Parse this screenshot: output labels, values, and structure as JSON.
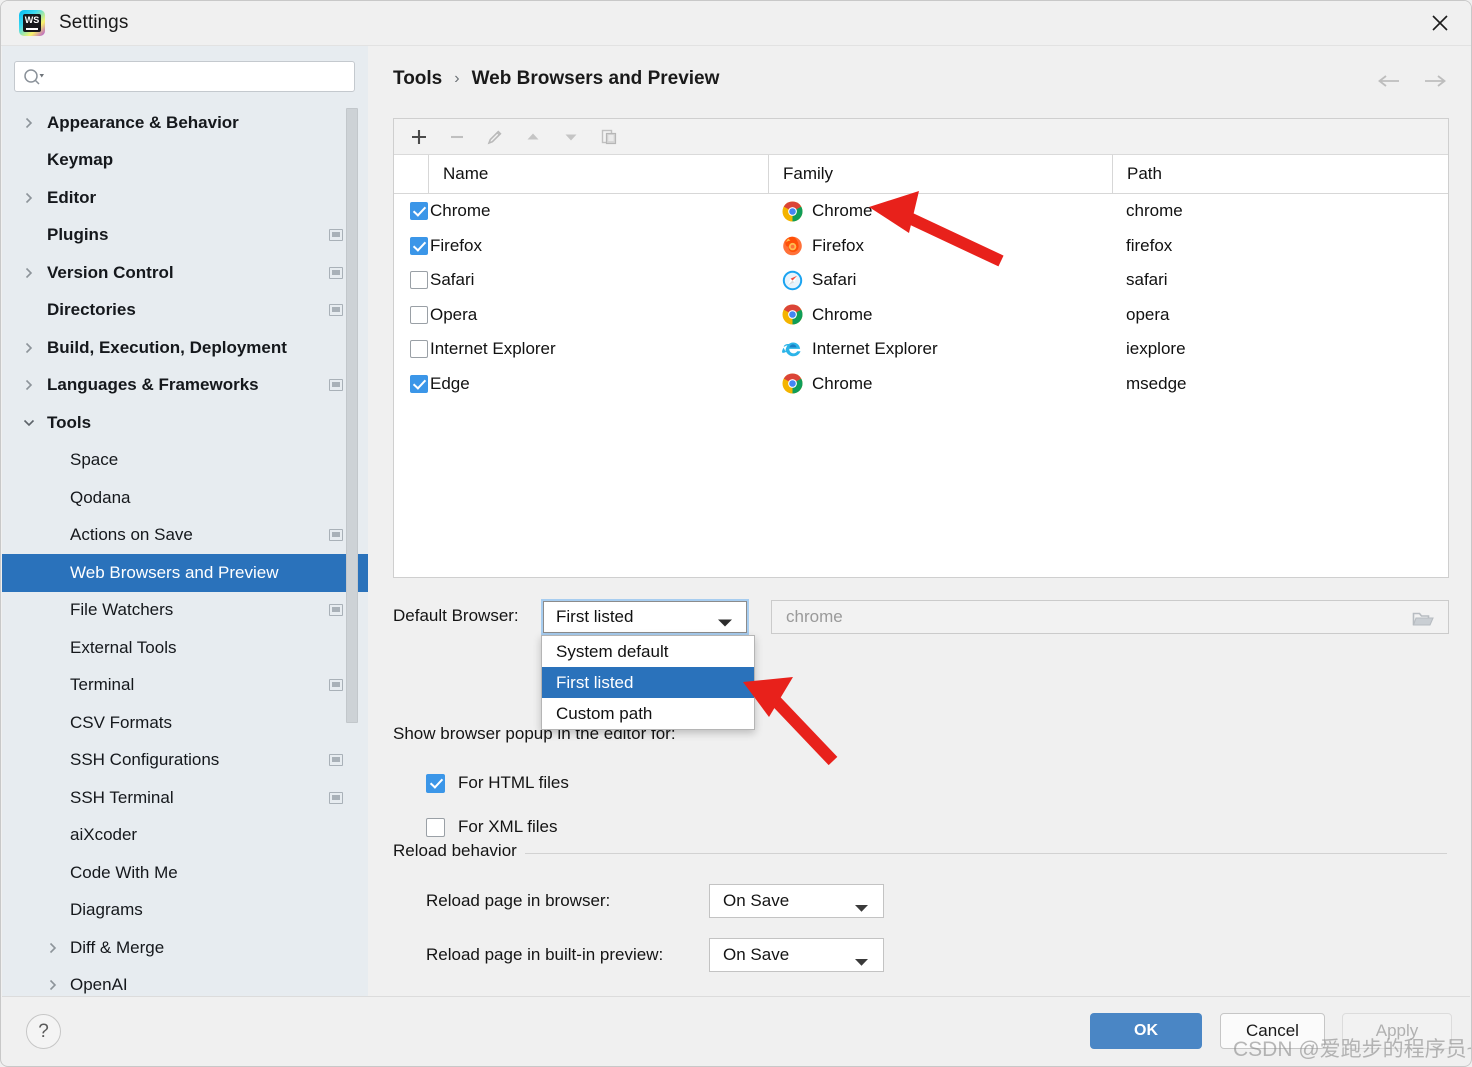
{
  "window": {
    "title": "Settings",
    "app_icon": "webstorm-logo-icon",
    "close_icon": "close-icon"
  },
  "sidebar": {
    "search": {
      "placeholder": "",
      "value": "",
      "icon": "search-icon"
    },
    "items": [
      {
        "label": "Appearance & Behavior",
        "level": 0,
        "bold": true,
        "arrow": "right",
        "badge": false,
        "selected": false
      },
      {
        "label": "Keymap",
        "level": 0,
        "bold": true,
        "arrow": "none",
        "badge": false,
        "selected": false
      },
      {
        "label": "Editor",
        "level": 0,
        "bold": true,
        "arrow": "right",
        "badge": false,
        "selected": false
      },
      {
        "label": "Plugins",
        "level": 0,
        "bold": true,
        "arrow": "none",
        "badge": true,
        "selected": false
      },
      {
        "label": "Version Control",
        "level": 0,
        "bold": true,
        "arrow": "right",
        "badge": true,
        "selected": false
      },
      {
        "label": "Directories",
        "level": 0,
        "bold": true,
        "arrow": "none",
        "badge": true,
        "selected": false
      },
      {
        "label": "Build, Execution, Deployment",
        "level": 0,
        "bold": true,
        "arrow": "right",
        "badge": false,
        "selected": false
      },
      {
        "label": "Languages & Frameworks",
        "level": 0,
        "bold": true,
        "arrow": "right",
        "badge": true,
        "selected": false
      },
      {
        "label": "Tools",
        "level": 0,
        "bold": true,
        "arrow": "down",
        "badge": false,
        "selected": false
      },
      {
        "label": "Space",
        "level": 1,
        "bold": false,
        "arrow": "none",
        "badge": false,
        "selected": false
      },
      {
        "label": "Qodana",
        "level": 1,
        "bold": false,
        "arrow": "none",
        "badge": false,
        "selected": false
      },
      {
        "label": "Actions on Save",
        "level": 1,
        "bold": false,
        "arrow": "none",
        "badge": true,
        "selected": false
      },
      {
        "label": "Web Browsers and Preview",
        "level": 1,
        "bold": false,
        "arrow": "none",
        "badge": false,
        "selected": true
      },
      {
        "label": "File Watchers",
        "level": 1,
        "bold": false,
        "arrow": "none",
        "badge": true,
        "selected": false
      },
      {
        "label": "External Tools",
        "level": 1,
        "bold": false,
        "arrow": "none",
        "badge": false,
        "selected": false
      },
      {
        "label": "Terminal",
        "level": 1,
        "bold": false,
        "arrow": "none",
        "badge": true,
        "selected": false
      },
      {
        "label": "CSV Formats",
        "level": 1,
        "bold": false,
        "arrow": "none",
        "badge": false,
        "selected": false
      },
      {
        "label": "SSH Configurations",
        "level": 1,
        "bold": false,
        "arrow": "none",
        "badge": true,
        "selected": false
      },
      {
        "label": "SSH Terminal",
        "level": 1,
        "bold": false,
        "arrow": "none",
        "badge": true,
        "selected": false
      },
      {
        "label": "aiXcoder",
        "level": 1,
        "bold": false,
        "arrow": "none",
        "badge": false,
        "selected": false
      },
      {
        "label": "Code With Me",
        "level": 1,
        "bold": false,
        "arrow": "none",
        "badge": false,
        "selected": false
      },
      {
        "label": "Diagrams",
        "level": 1,
        "bold": false,
        "arrow": "none",
        "badge": false,
        "selected": false
      },
      {
        "label": "Diff & Merge",
        "level": 1,
        "bold": false,
        "arrow": "right",
        "badge": false,
        "selected": false
      },
      {
        "label": "OpenAI",
        "level": 1,
        "bold": false,
        "arrow": "right",
        "badge": false,
        "selected": false
      }
    ]
  },
  "main": {
    "breadcrumb": {
      "parent": "Tools",
      "separator": "›",
      "current": "Web Browsers and Preview"
    },
    "nav": {
      "back_icon": "arrow-left-icon",
      "forward_icon": "arrow-right-icon"
    },
    "toolbar": [
      {
        "name": "add-button",
        "icon": "plus-icon",
        "enabled": true
      },
      {
        "name": "remove-button",
        "icon": "minus-icon",
        "enabled": false
      },
      {
        "name": "edit-button",
        "icon": "pencil-icon",
        "enabled": false
      },
      {
        "name": "move-up-button",
        "icon": "arrow-up-icon",
        "enabled": false
      },
      {
        "name": "move-down-button",
        "icon": "arrow-down-icon",
        "enabled": false
      },
      {
        "name": "copy-button",
        "icon": "copy-icon",
        "enabled": false
      }
    ],
    "table": {
      "columns": [
        "Name",
        "Family",
        "Path"
      ],
      "rows": [
        {
          "checked": true,
          "name": "Chrome",
          "family": "Chrome",
          "family_icon": "chrome-icon",
          "path": "chrome"
        },
        {
          "checked": true,
          "name": "Firefox",
          "family": "Firefox",
          "family_icon": "firefox-icon",
          "path": "firefox"
        },
        {
          "checked": false,
          "name": "Safari",
          "family": "Safari",
          "family_icon": "safari-icon",
          "path": "safari"
        },
        {
          "checked": false,
          "name": "Opera",
          "family": "Chrome",
          "family_icon": "chrome-icon",
          "path": "opera"
        },
        {
          "checked": false,
          "name": "Internet Explorer",
          "family": "Internet Explorer",
          "family_icon": "ie-icon",
          "path": "iexplore"
        },
        {
          "checked": true,
          "name": "Edge",
          "family": "Chrome",
          "family_icon": "chrome-icon",
          "path": "msedge"
        }
      ]
    },
    "default_browser": {
      "label": "Default Browser:",
      "value": "First listed",
      "caret_icon": "chevron-down-icon",
      "options": [
        {
          "label": "System default",
          "selected": false
        },
        {
          "label": "First listed",
          "selected": true
        },
        {
          "label": "Custom path",
          "selected": false
        }
      ],
      "path_field": {
        "value": "chrome",
        "browse_icon": "folder-open-icon"
      }
    },
    "browser_popup": {
      "label": "Show browser popup in the editor for:",
      "options": [
        {
          "label": "For HTML files",
          "checked": true
        },
        {
          "label": "For XML files",
          "checked": false
        }
      ]
    },
    "reload_behavior": {
      "title": "Reload behavior",
      "rows": [
        {
          "label": "Reload page in browser:",
          "value": "On Save",
          "caret_icon": "chevron-down-icon"
        },
        {
          "label": "Reload page in built-in preview:",
          "value": "On Save",
          "caret_icon": "chevron-down-icon"
        }
      ]
    }
  },
  "footer": {
    "help_icon": "question-mark-icon",
    "ok_label": "OK",
    "cancel_label": "Cancel",
    "apply_label": "Apply"
  },
  "watermark": {
    "text": "CSDN @爱跑步的程序员~"
  },
  "colors": {
    "accent": "#2a72bb",
    "ok_button": "#4a86c5",
    "checkbox_on": "#3b96e8",
    "sidebar_bg": "#e7ecf0",
    "annotation_arrow": "#e8211b"
  }
}
